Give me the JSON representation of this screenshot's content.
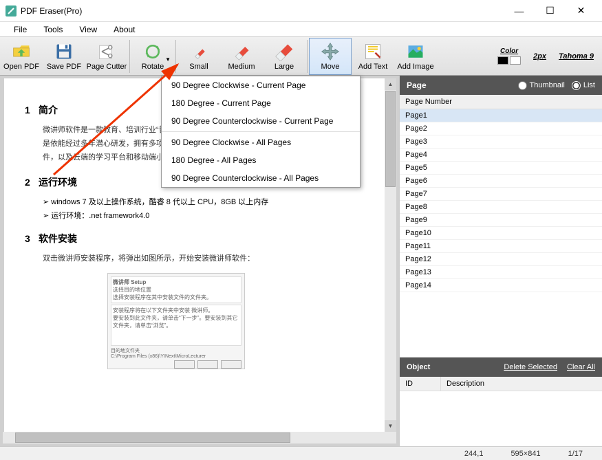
{
  "window": {
    "title": "PDF Eraser(Pro)"
  },
  "menubar": {
    "items": [
      "File",
      "Tools",
      "View",
      "About"
    ]
  },
  "toolbar": {
    "open_pdf": "Open PDF",
    "save_pdf": "Save PDF",
    "page_cutter": "Page Cutter",
    "rotate": "Rotate",
    "small": "Small",
    "medium": "Medium",
    "large": "Large",
    "move": "Move",
    "add_text": "Add Text",
    "add_image": "Add Image",
    "color_label": "Color",
    "px_label": "2px",
    "font_label": "Tahoma 9"
  },
  "rotate_menu": {
    "group1": [
      "90 Degree Clockwise - Current Page",
      "180 Degree - Current Page",
      "90 Degree Counterclockwise - Current Page"
    ],
    "group2": [
      "90 Degree Clockwise - All Pages",
      "180 Degree - All Pages",
      "90 Degree Counterclockwise - All Pages"
    ]
  },
  "document": {
    "h1_num": "1",
    "h1": "简介",
    "p1": "微讲师软件是一款教育、培训行业“普遍适用、人人能用、易学好用、无师自通”的教学支撑软件，是依能经过多年潜心研发，拥有多项专利技术的产品。它是由运行在 PC 端的电子板书、录课软件，以及云端的学习平台和移动端小程序组成。",
    "h2_num": "2",
    "h2": "运行环境",
    "b1": "windows 7 及以上操作系统，酷睿 8 代以上 CPU，8GB 以上内存",
    "b2": "运行环境：.net framework4.0",
    "h3_num": "3",
    "h3": "软件安装",
    "p2": "双击微讲师安装程序，将弹出如图所示，开始安装微讲师软件：",
    "embed_title": "微讲师 Setup",
    "embed_sub": "选择目的地位置",
    "embed_line": "选择安装程序在其中安装文件的文件夹。",
    "embed_body1": "安装程序将在以下文件夹中安装 微讲师。",
    "embed_body2": "要安装到此文件夹，请单击“下一步”。要安装到其它文件夹，请单击“浏览”。",
    "embed_foot": "目的地文件夹",
    "embed_path": "C:\\Program Files (x86)\\YINext\\MicroLecturer"
  },
  "page_panel": {
    "title": "Page",
    "thumbnail": "Thumbnail",
    "list": "List",
    "header": "Page Number",
    "pages": [
      "Page1",
      "Page2",
      "Page3",
      "Page4",
      "Page5",
      "Page6",
      "Page7",
      "Page8",
      "Page9",
      "Page10",
      "Page11",
      "Page12",
      "Page13",
      "Page14"
    ],
    "selected": 0
  },
  "object_panel": {
    "title": "Object",
    "delete": "Delete Selected",
    "clear": "Clear All",
    "col_id": "ID",
    "col_desc": "Description"
  },
  "statusbar": {
    "pos": "244,1",
    "dim": "595×841",
    "page": "1/17"
  }
}
